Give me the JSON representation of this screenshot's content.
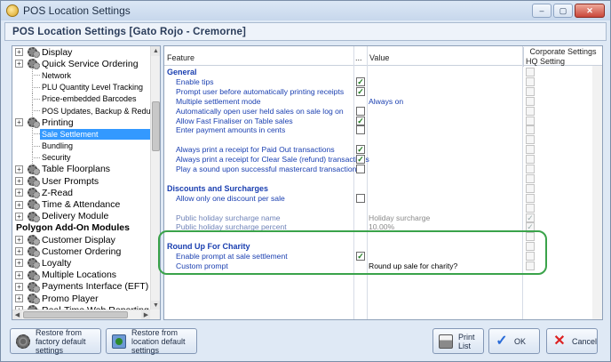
{
  "window": {
    "title": "POS Location Settings",
    "header": "POS Location Settings  [Gato Rojo - Cremorne]"
  },
  "tree": {
    "items": [
      {
        "label": "Display",
        "kind": "top",
        "expander": "+"
      },
      {
        "label": "Quick Service Ordering",
        "kind": "top",
        "expander": "+"
      },
      {
        "label": "Network",
        "kind": "sub"
      },
      {
        "label": "PLU Quantity Level Tracking",
        "kind": "sub"
      },
      {
        "label": "Price-embedded Barcodes",
        "kind": "sub"
      },
      {
        "label": "POS Updates, Backup & Redundancy",
        "kind": "sub"
      },
      {
        "label": "Printing",
        "kind": "top",
        "expander": "+"
      },
      {
        "label": "Sale Settlement",
        "kind": "sub",
        "selected": true
      },
      {
        "label": "Bundling",
        "kind": "sub"
      },
      {
        "label": "Security",
        "kind": "sub"
      },
      {
        "label": "Table Floorplans",
        "kind": "top",
        "expander": "+"
      },
      {
        "label": "User Prompts",
        "kind": "top",
        "expander": "+"
      },
      {
        "label": "Z-Read",
        "kind": "top",
        "expander": "+"
      },
      {
        "label": "Time & Attendance",
        "kind": "top",
        "expander": "+"
      },
      {
        "label": "Delivery Module",
        "kind": "top",
        "expander": "+"
      },
      {
        "label": "Polygon Add-On Modules",
        "kind": "group"
      },
      {
        "label": "Customer Display",
        "kind": "top",
        "expander": "+"
      },
      {
        "label": "Customer Ordering",
        "kind": "top",
        "expander": "+"
      },
      {
        "label": "Loyalty",
        "kind": "top",
        "expander": "+"
      },
      {
        "label": "Multiple Locations",
        "kind": "top",
        "expander": "+"
      },
      {
        "label": "Payments Interface (EFT)",
        "kind": "top",
        "expander": "+"
      },
      {
        "label": "Promo Player",
        "kind": "top",
        "expander": "+"
      },
      {
        "label": "Real-Time Web Reporting",
        "kind": "top",
        "expander": "+"
      }
    ]
  },
  "grid": {
    "headers": {
      "feature": "Feature",
      "dots": "...",
      "value": "Value",
      "corporate": "Corporate Settings",
      "hq": "HQ Setting"
    },
    "rows": [
      {
        "feature": "General",
        "section": true
      },
      {
        "feature": "Enable tips",
        "checked": true
      },
      {
        "feature": "Prompt user before automatically printing receipts",
        "checked": true
      },
      {
        "feature": "Multiple settlement mode",
        "value": "Always on"
      },
      {
        "feature": "Automatically open user held sales on sale log on",
        "checked": false
      },
      {
        "feature": "Allow Fast Finaliser on Table sales",
        "checked": true
      },
      {
        "feature": "Enter payment amounts in cents",
        "checked": false
      },
      {
        "feature": ""
      },
      {
        "feature": "Always print a receipt for Paid Out transactions",
        "checked": true
      },
      {
        "feature": "Always print a receipt for Clear Sale (refund) transactions",
        "checked": true
      },
      {
        "feature": "Play a sound upon successful mastercard transaction",
        "checked": false
      },
      {
        "feature": ""
      },
      {
        "feature": "Discounts and Surcharges",
        "section": true
      },
      {
        "feature": "Allow only one discount per sale",
        "checked": false
      },
      {
        "feature": ""
      },
      {
        "feature": "Public holiday surcharge name",
        "value": "Holiday surcharge",
        "dim": true,
        "hq_checked": true
      },
      {
        "feature": "Public holiday surcharge percent",
        "value": "10.00%",
        "dim": true,
        "hq_checked": true
      },
      {
        "feature": ""
      },
      {
        "feature": "Round Up For Charity",
        "section": true
      },
      {
        "feature": "Enable prompt at sale settlement",
        "checked": true
      },
      {
        "feature": "Custom prompt",
        "value": "Round up sale for charity?",
        "black": true
      }
    ]
  },
  "buttons": {
    "restore_factory": "Restore from factory default settings",
    "restore_location": "Restore from location default settings",
    "print_list": "Print List",
    "ok": "OK",
    "cancel": "Cancel"
  },
  "icons": {
    "check": "✓",
    "minimize": "–",
    "maximize": "▢",
    "close": "✕"
  }
}
